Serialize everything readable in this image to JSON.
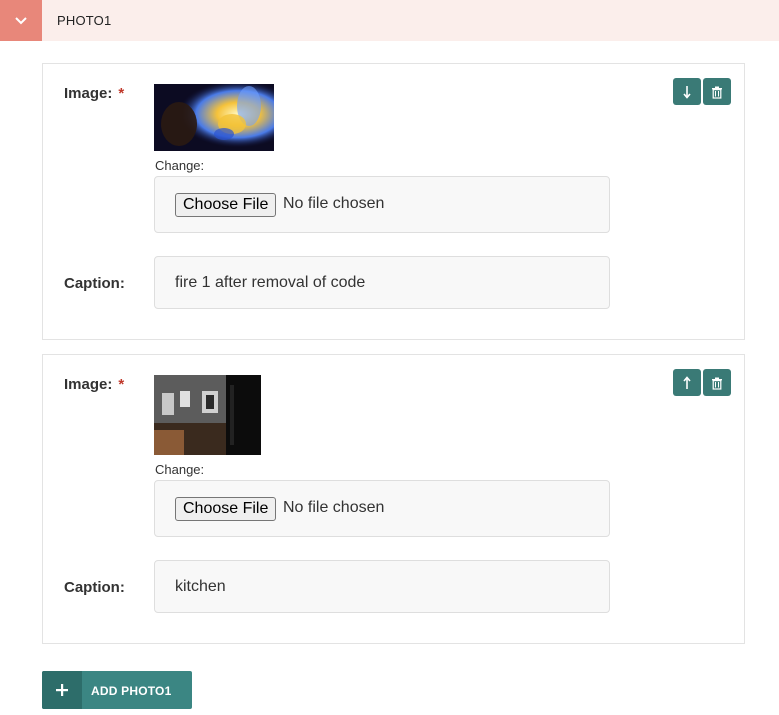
{
  "section": {
    "title": "PHOTO1",
    "toggle_icon": "chevron-down-icon"
  },
  "photos": [
    {
      "image_label": "Image:",
      "required_mark": "*",
      "change_label": "Change:",
      "choose_file_label": "Choose File",
      "no_file_text": "No file chosen",
      "caption_label": "Caption:",
      "caption_value": "fire 1 after removal of code",
      "move_icon": "arrow-down-icon",
      "delete_icon": "trash-icon"
    },
    {
      "image_label": "Image:",
      "required_mark": "*",
      "change_label": "Change:",
      "choose_file_label": "Choose File",
      "no_file_text": "No file chosen",
      "caption_label": "Caption:",
      "caption_value": "kitchen",
      "move_icon": "arrow-up-icon",
      "delete_icon": "trash-icon"
    }
  ],
  "add_button": {
    "label": "ADD PHOTO1",
    "icon": "plus-icon"
  },
  "colors": {
    "header_bg": "#fbeeeb",
    "toggle_bg": "#e8877a",
    "action_bg": "#3a7a76",
    "add_bg": "#3b8683",
    "required": "#c0392b"
  }
}
